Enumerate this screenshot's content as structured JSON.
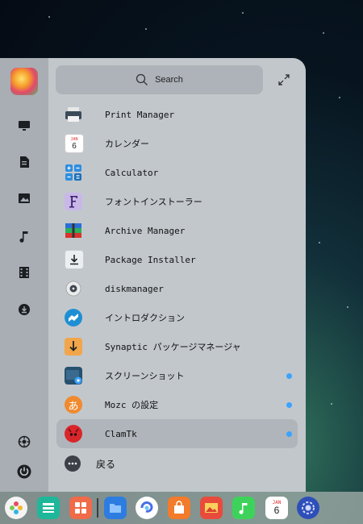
{
  "search": {
    "placeholder": "Search",
    "icon": "search-icon"
  },
  "sidebar": {
    "items": [
      {
        "name": "computer",
        "icon": "monitor-icon"
      },
      {
        "name": "documents",
        "icon": "document-icon"
      },
      {
        "name": "pictures",
        "icon": "image-icon"
      },
      {
        "name": "music",
        "icon": "music-icon"
      },
      {
        "name": "videos",
        "icon": "film-icon"
      },
      {
        "name": "downloads",
        "icon": "download-icon"
      },
      {
        "name": "settings",
        "icon": "settings-icon"
      },
      {
        "name": "power",
        "icon": "power-icon"
      }
    ]
  },
  "apps": [
    {
      "label": "Print Manager",
      "icon": "printer-icon",
      "new": false
    },
    {
      "label": "カレンダー",
      "icon": "calendar-icon",
      "new": false
    },
    {
      "label": "Calculator",
      "icon": "calculator-icon",
      "new": false
    },
    {
      "label": "フォントインストーラー",
      "icon": "font-icon",
      "new": false
    },
    {
      "label": "Archive Manager",
      "icon": "archive-icon",
      "new": false
    },
    {
      "label": "Package Installer",
      "icon": "package-icon",
      "new": false
    },
    {
      "label": "diskmanager",
      "icon": "disk-icon",
      "new": false
    },
    {
      "label": "イントロダクション",
      "icon": "introduction-icon",
      "new": false
    },
    {
      "label": "Synaptic パッケージマネージャ",
      "icon": "synaptic-icon",
      "new": false
    },
    {
      "label": "スクリーンショット",
      "icon": "screenshot-icon",
      "new": true
    },
    {
      "label": "Mozc の設定",
      "icon": "mozc-icon",
      "new": true
    },
    {
      "label": "ClamTk",
      "icon": "clamtk-icon",
      "new": true,
      "selected": true
    }
  ],
  "back": {
    "label": "戻る",
    "icon": "more-icon"
  },
  "calendar_icon": {
    "month": "JAN",
    "day": "6"
  },
  "dock": {
    "items": [
      {
        "name": "launcher",
        "icon": "launcher-icon"
      },
      {
        "name": "multitask",
        "icon": "multitask-icon"
      },
      {
        "name": "desktop",
        "icon": "desktop-icon"
      },
      {
        "name": "file-manager",
        "icon": "folder-icon"
      },
      {
        "name": "browser",
        "icon": "browser-icon"
      },
      {
        "name": "app-store",
        "icon": "app-store-icon"
      },
      {
        "name": "image-viewer",
        "icon": "photo-icon"
      },
      {
        "name": "music-player",
        "icon": "music-player-icon"
      },
      {
        "name": "calendar",
        "icon": "calendar-icon"
      },
      {
        "name": "control-center",
        "icon": "control-center-icon"
      }
    ]
  },
  "colors": {
    "accent": "#3aa3ff",
    "launcher_bg": "#c2c7cc",
    "sidebar_bg": "#a8aeb4"
  }
}
